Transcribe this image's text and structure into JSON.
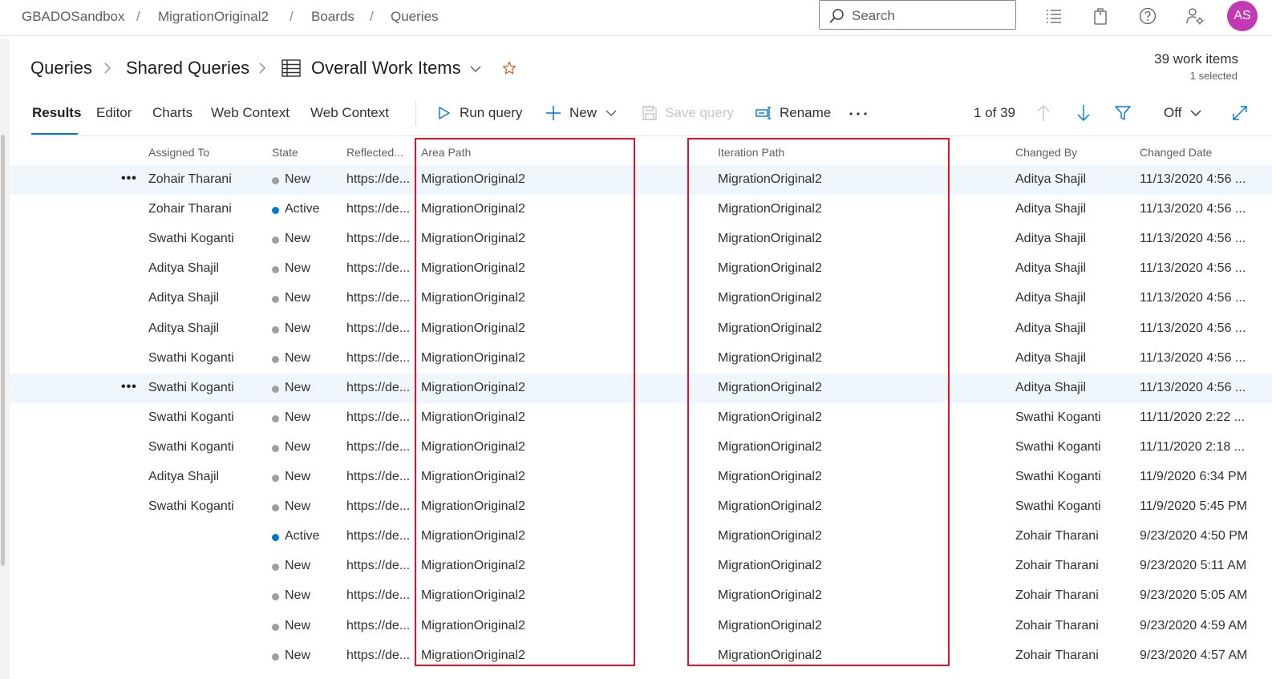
{
  "breadcrumb": {
    "items": [
      "GBADOSandbox",
      "MigrationOriginal2",
      "Boards",
      "Queries"
    ],
    "separator": "/"
  },
  "search": {
    "placeholder": "Search"
  },
  "user": {
    "initials": "AS",
    "avatar_color": "#c239b3"
  },
  "header": {
    "path": [
      "Queries",
      "Shared Queries"
    ],
    "query_name": "Overall Work Items",
    "count": "39 work items",
    "selected": "1 selected"
  },
  "tabs": [
    "Results",
    "Editor",
    "Charts",
    "Web Context",
    "Web Context"
  ],
  "toolbar": {
    "run_query": "Run query",
    "new": "New",
    "save_query": "Save query",
    "rename": "Rename",
    "position": "1 of 39",
    "filter_state": "Off"
  },
  "columns": {
    "assigned_to": "Assigned To",
    "state": "State",
    "reflected": "Reflected...",
    "area_path": "Area Path",
    "iteration_path": "Iteration Path",
    "changed_by": "Changed By",
    "changed_date": "Changed Date"
  },
  "colors": {
    "accent": "#0078d4",
    "state_new": "#a19f9d",
    "state_active": "#0078d4",
    "highlight_box": "#e81123",
    "row_highlight": "#eff6fc"
  },
  "rows": [
    {
      "assigned_to": "Zohair Tharani",
      "state": "New",
      "reflected": "https://de...",
      "area_path": "MigrationOriginal2",
      "iteration_path": "MigrationOriginal2",
      "changed_by": "Aditya Shajil",
      "changed_date": "11/13/2020 4:56 ...",
      "highlighted": true,
      "more": "•••"
    },
    {
      "assigned_to": "Zohair Tharani",
      "state": "Active",
      "reflected": "https://de...",
      "area_path": "MigrationOriginal2",
      "iteration_path": "MigrationOriginal2",
      "changed_by": "Aditya Shajil",
      "changed_date": "11/13/2020 4:56 ..."
    },
    {
      "assigned_to": "Swathi Koganti",
      "state": "New",
      "reflected": "https://de...",
      "area_path": "MigrationOriginal2",
      "iteration_path": "MigrationOriginal2",
      "changed_by": "Aditya Shajil",
      "changed_date": "11/13/2020 4:56 ..."
    },
    {
      "assigned_to": "Aditya Shajil",
      "state": "New",
      "reflected": "https://de...",
      "area_path": "MigrationOriginal2",
      "iteration_path": "MigrationOriginal2",
      "changed_by": "Aditya Shajil",
      "changed_date": "11/13/2020 4:56 ..."
    },
    {
      "assigned_to": "Aditya Shajil",
      "state": "New",
      "reflected": "https://de...",
      "area_path": "MigrationOriginal2",
      "iteration_path": "MigrationOriginal2",
      "changed_by": "Aditya Shajil",
      "changed_date": "11/13/2020 4:56 ..."
    },
    {
      "assigned_to": "Aditya Shajil",
      "state": "New",
      "reflected": "https://de...",
      "area_path": "MigrationOriginal2",
      "iteration_path": "MigrationOriginal2",
      "changed_by": "Aditya Shajil",
      "changed_date": "11/13/2020 4:56 ..."
    },
    {
      "assigned_to": "Swathi Koganti",
      "state": "New",
      "reflected": "https://de...",
      "area_path": "MigrationOriginal2",
      "iteration_path": "MigrationOriginal2",
      "changed_by": "Aditya Shajil",
      "changed_date": "11/13/2020 4:56 ..."
    },
    {
      "assigned_to": "Swathi Koganti",
      "state": "New",
      "reflected": "https://de...",
      "area_path": "MigrationOriginal2",
      "iteration_path": "MigrationOriginal2",
      "changed_by": "Aditya Shajil",
      "changed_date": "11/13/2020 4:56 ...",
      "highlighted": true,
      "more": "•••"
    },
    {
      "assigned_to": "Swathi Koganti",
      "state": "New",
      "reflected": "https://de...",
      "area_path": "MigrationOriginal2",
      "iteration_path": "MigrationOriginal2",
      "changed_by": "Swathi Koganti",
      "changed_date": "11/11/2020 2:22 ..."
    },
    {
      "assigned_to": "Swathi Koganti",
      "state": "New",
      "reflected": "https://de...",
      "area_path": "MigrationOriginal2",
      "iteration_path": "MigrationOriginal2",
      "changed_by": "Swathi Koganti",
      "changed_date": "11/11/2020 2:18 ..."
    },
    {
      "assigned_to": "Aditya Shajil",
      "state": "New",
      "reflected": "https://de...",
      "area_path": "MigrationOriginal2",
      "iteration_path": "MigrationOriginal2",
      "changed_by": "Swathi Koganti",
      "changed_date": "11/9/2020 6:34 PM"
    },
    {
      "assigned_to": "Swathi Koganti",
      "state": "New",
      "reflected": "https://de...",
      "area_path": "MigrationOriginal2",
      "iteration_path": "MigrationOriginal2",
      "changed_by": "Swathi Koganti",
      "changed_date": "11/9/2020 5:45 PM"
    },
    {
      "assigned_to": "",
      "state": "Active",
      "reflected": "https://de...",
      "area_path": "MigrationOriginal2",
      "iteration_path": "MigrationOriginal2",
      "changed_by": "Zohair Tharani",
      "changed_date": "9/23/2020 4:50 PM"
    },
    {
      "assigned_to": "",
      "state": "New",
      "reflected": "https://de...",
      "area_path": "MigrationOriginal2",
      "iteration_path": "MigrationOriginal2",
      "changed_by": "Zohair Tharani",
      "changed_date": "9/23/2020 5:11 AM"
    },
    {
      "assigned_to": "",
      "state": "New",
      "reflected": "https://de...",
      "area_path": "MigrationOriginal2",
      "iteration_path": "MigrationOriginal2",
      "changed_by": "Zohair Tharani",
      "changed_date": "9/23/2020 5:05 AM"
    },
    {
      "assigned_to": "",
      "state": "New",
      "reflected": "https://de...",
      "area_path": "MigrationOriginal2",
      "iteration_path": "MigrationOriginal2",
      "changed_by": "Zohair Tharani",
      "changed_date": "9/23/2020 4:59 AM"
    },
    {
      "assigned_to": "",
      "state": "New",
      "reflected": "https://de...",
      "area_path": "MigrationOriginal2",
      "iteration_path": "MigrationOriginal2",
      "changed_by": "Zohair Tharani",
      "changed_date": "9/23/2020 4:57 AM"
    }
  ]
}
